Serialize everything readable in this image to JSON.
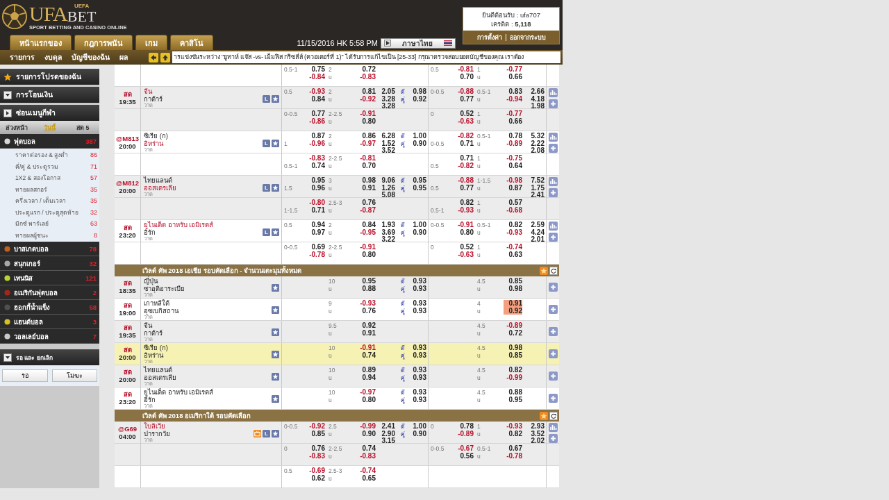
{
  "header": {
    "logo": {
      "brand_left": "UFA",
      "brand_right": "BET",
      "badge": "UEFA",
      "tagline": "SPORT BETTING AND CASINO ONLINE"
    },
    "nav": [
      "หน้าแรกของ",
      "กฎการพนัน",
      "เกม",
      "คาสิโน"
    ],
    "datetime": "11/15/2016 HK 5:58 PM",
    "language": "ภาษาไทย",
    "account": {
      "welcome_label": "ยินดีต้อนรับ :",
      "user": "ufa707",
      "credit_label": "เครดิต :",
      "credit": "5,118",
      "links": [
        "การตั้งค่า",
        "ออกจากระบบ"
      ]
    },
    "submenu": [
      "รายการ",
      "งบดุล",
      "บัญชีของฉัน",
      "ผล"
    ],
    "ticker": "ารแข่งขันระหว่าง \"ยูทาห์ แจ๊ส -vs- เม็มฟิส กริซลี่ส์ (ควอเตอร์ที่ 1)\" ได้รับการแก้ไขเป็น [25-33] กรุณาตรวจสอบยอดบัญชีของคุณ เราต้อง"
  },
  "sidebar": {
    "panels": [
      {
        "kind": "favorites",
        "label": "รายการโปรดของฉัน"
      },
      {
        "kind": "collapse",
        "label": "การโอนเงิน"
      },
      {
        "kind": "expand",
        "label": "ซ่อนเมนูกีฬา"
      }
    ],
    "tabs": [
      {
        "label": "ล่วงหน้า",
        "selected": false
      },
      {
        "label": "วันนี้",
        "selected": true
      },
      {
        "label": "สด 5",
        "selected": false
      }
    ],
    "sports": [
      {
        "name": "ฟุตบอล",
        "count": "387",
        "color": "#d8d8d8",
        "children": [
          {
            "name": "ราคาต่อรอง & สูงต่ำ",
            "count": "86"
          },
          {
            "name": "คี่/คู่ & ประตูรวม",
            "count": "71"
          },
          {
            "name": "1X2 & สองโอกาส",
            "count": "57"
          },
          {
            "name": "ทายผลสกอร์",
            "count": "35"
          },
          {
            "name": "ครึ่งเวลา / เต็มเวลา",
            "count": "35"
          },
          {
            "name": "ประตูแรก / ประตูสุดท้าย",
            "count": "32"
          },
          {
            "name": "มิกซ์ พาร์เลย์",
            "count": "63"
          },
          {
            "name": "ทายผลผู้ชนะ",
            "count": "8"
          }
        ]
      },
      {
        "name": "บาสเกตบอล",
        "count": "78",
        "color": "#c0601a"
      },
      {
        "name": "สนุกเกอร์",
        "count": "32",
        "color": "#a8a8a8"
      },
      {
        "name": "เทนนิส",
        "count": "121",
        "color": "#b8d430"
      },
      {
        "name": "อเมริกันฟุตบอล",
        "count": "2",
        "color": "#a02818"
      },
      {
        "name": "ฮอกกี้น้ำแข็ง",
        "count": "58",
        "color": "#505050"
      },
      {
        "name": "แฮนด์บอล",
        "count": "3",
        "color": "#d8c020"
      },
      {
        "name": "วอลเลย์บอล",
        "count": "7",
        "color": "#c8c8c8"
      }
    ],
    "bottom_panel": {
      "kind": "collapse",
      "label": "รอ และ ยกเลิก"
    },
    "buttons": [
      "รอ",
      "โมฆะ"
    ]
  },
  "sections": [
    {
      "lines": [
        {
          "shaded": false,
          "highlighted": false,
          "ft": {
            "hl": "0.5-1",
            "hl_low": false,
            "hdp": [
              {
                "v": "0.75",
                "red": false
              },
              {
                "v": "-0.84",
                "red": true
              }
            ],
            "ou": [
              "2",
              "u"
            ],
            "ouo": [
              {
                "v": "0.72",
                "red": false
              },
              {
                "v": "-0.83",
                "red": true
              }
            ]
          },
          "h1": {
            "hl": "0.5",
            "hl_low": false,
            "hdp": [
              {
                "v": "-0.81",
                "red": true
              },
              {
                "v": "0.70",
                "red": false
              }
            ],
            "ou": [
              "1",
              "u"
            ],
            "ouo": [
              {
                "v": "-0.77",
                "red": true
              },
              {
                "v": "0.66",
                "red": false
              }
            ]
          }
        },
        {
          "shaded": true,
          "highlighted": false,
          "time": {
            "status": "สด",
            "clock": "19:35"
          },
          "teams": [
            {
              "name": "จีน",
              "fav": true
            },
            {
              "name": "กาต้าร์",
              "fav": false
            }
          ],
          "draw": "วาด",
          "icons": [
            {
              "kind": "live",
              "label": "L"
            },
            {
              "kind": "fav"
            }
          ],
          "actions": [
            {
              "kind": "stats"
            },
            {
              "kind": "add"
            }
          ],
          "ft": {
            "hl": "0.5",
            "hl_low": false,
            "hdp": [
              {
                "v": "-0.93",
                "red": true
              },
              {
                "v": "0.84",
                "red": false
              }
            ],
            "ou": [
              "2",
              "u"
            ],
            "ouo": [
              {
                "v": "0.81",
                "red": false
              },
              {
                "v": "-0.92",
                "red": true
              }
            ],
            "x12": [
              "2.05",
              "3.28",
              "3.28"
            ],
            "oe": [
              "ดี",
              "คู่"
            ],
            "oeo": [
              "0.98",
              "0.92"
            ]
          },
          "h1": {
            "hl": "0-0.5",
            "hl_low": false,
            "hdp": [
              {
                "v": "-0.88",
                "red": true
              },
              {
                "v": "0.77",
                "red": false
              }
            ],
            "ou": [
              "0.5-1",
              "u"
            ],
            "ouo": [
              {
                "v": "0.83",
                "red": false
              },
              {
                "v": "-0.94",
                "red": true
              }
            ],
            "x12": [
              "2.66",
              "4.18",
              "1.98"
            ]
          }
        },
        {
          "shaded": true,
          "highlighted": false,
          "ft": {
            "hl": "0-0.5",
            "hl_low": false,
            "hdp": [
              {
                "v": "0.77",
                "red": false
              },
              {
                "v": "-0.86",
                "red": true
              }
            ],
            "ou": [
              "2-2.5",
              "u"
            ],
            "ouo": [
              {
                "v": "-0.91",
                "red": true
              },
              {
                "v": "0.80",
                "red": false
              }
            ]
          },
          "h1": {
            "hl": "0",
            "hl_low": false,
            "hdp": [
              {
                "v": "0.52",
                "red": false
              },
              {
                "v": "-0.63",
                "red": true
              }
            ],
            "ou": [
              "1",
              "u"
            ],
            "ouo": [
              {
                "v": "-0.77",
                "red": true
              },
              {
                "v": "0.66",
                "red": false
              }
            ]
          }
        },
        {
          "shaded": false,
          "highlighted": false,
          "time": {
            "status": "@M813",
            "clock": "20:00"
          },
          "teams": [
            {
              "name": "ซีเรีย (ก)",
              "fav": false
            },
            {
              "name": "อิหร่าน",
              "fav": true
            }
          ],
          "draw": "วาด",
          "icons": [
            {
              "kind": "live",
              "label": "L"
            },
            {
              "kind": "fav"
            }
          ],
          "actions": [
            {
              "kind": "stats"
            },
            {
              "kind": "add"
            }
          ],
          "ft": {
            "hl": "1",
            "hl_low": true,
            "hdp": [
              {
                "v": "0.87",
                "red": false
              },
              {
                "v": "-0.96",
                "red": true
              }
            ],
            "ou": [
              "2",
              "u"
            ],
            "ouo": [
              {
                "v": "0.86",
                "red": false
              },
              {
                "v": "-0.97",
                "red": true
              }
            ],
            "x12": [
              "6.28",
              "1.52",
              "3.52"
            ],
            "oe": [
              "ดี",
              "คู่"
            ],
            "oeo": [
              "1.00",
              "0.90"
            ]
          },
          "h1": {
            "hl": "0-0.5",
            "hl_low": true,
            "hdp": [
              {
                "v": "-0.82",
                "red": true
              },
              {
                "v": "0.71",
                "red": false
              }
            ],
            "ou": [
              "0.5-1",
              "u"
            ],
            "ouo": [
              {
                "v": "0.78",
                "red": false
              },
              {
                "v": "-0.89",
                "red": true
              }
            ],
            "x12": [
              "5.32",
              "2.22",
              "2.08"
            ]
          }
        },
        {
          "shaded": false,
          "highlighted": false,
          "ft": {
            "hl": "0.5-1",
            "hl_low": true,
            "hdp": [
              {
                "v": "-0.83",
                "red": true
              },
              {
                "v": "0.74",
                "red": false
              }
            ],
            "ou": [
              "2-2.5",
              "u"
            ],
            "ouo": [
              {
                "v": "-0.81",
                "red": true
              },
              {
                "v": "0.70",
                "red": false
              }
            ]
          },
          "h1": {
            "hl": "0.5",
            "hl_low": true,
            "hdp": [
              {
                "v": "0.71",
                "red": false
              },
              {
                "v": "-0.82",
                "red": true
              }
            ],
            "ou": [
              "1",
              "u"
            ],
            "ouo": [
              {
                "v": "-0.75",
                "red": true
              },
              {
                "v": "0.64",
                "red": false
              }
            ]
          }
        },
        {
          "shaded": true,
          "highlighted": false,
          "time": {
            "status": "@M812",
            "clock": "20:00"
          },
          "teams": [
            {
              "name": "ไทยแลนด์",
              "fav": false
            },
            {
              "name": "ออสเตรเลีย",
              "fav": true
            }
          ],
          "draw": "วาด",
          "icons": [
            {
              "kind": "live",
              "label": "L"
            },
            {
              "kind": "fav"
            }
          ],
          "actions": [
            {
              "kind": "stats"
            },
            {
              "kind": "add"
            }
          ],
          "ft": {
            "hl": "1.5",
            "hl_low": true,
            "hdp": [
              {
                "v": "0.95",
                "red": false
              },
              {
                "v": "0.96",
                "red": false
              }
            ],
            "ou": [
              "3",
              "u"
            ],
            "ouo": [
              {
                "v": "0.98",
                "red": false
              },
              {
                "v": "0.91",
                "red": false
              }
            ],
            "x12": [
              "9.06",
              "1.26",
              "5.08"
            ],
            "oe": [
              "ดี",
              "คู่"
            ],
            "oeo": [
              "0.95",
              "0.95"
            ]
          },
          "h1": {
            "hl": "0.5",
            "hl_low": true,
            "hdp": [
              {
                "v": "-0.88",
                "red": true
              },
              {
                "v": "0.77",
                "red": false
              }
            ],
            "ou": [
              "1-1.5",
              "u"
            ],
            "ouo": [
              {
                "v": "-0.98",
                "red": true
              },
              {
                "v": "0.87",
                "red": false
              }
            ],
            "x12": [
              "7.52",
              "1.75",
              "2.41"
            ]
          }
        },
        {
          "shaded": true,
          "highlighted": false,
          "ft": {
            "hl": "1-1.5",
            "hl_low": true,
            "hdp": [
              {
                "v": "-0.80",
                "red": true
              },
              {
                "v": "0.71",
                "red": false
              }
            ],
            "ou": [
              "2.5-3",
              "u"
            ],
            "ouo": [
              {
                "v": "0.76",
                "red": false
              },
              {
                "v": "-0.87",
                "red": true
              }
            ]
          },
          "h1": {
            "hl": "0.5-1",
            "hl_low": true,
            "hdp": [
              {
                "v": "0.82",
                "red": false
              },
              {
                "v": "-0.93",
                "red": true
              }
            ],
            "ou": [
              "1",
              "u"
            ],
            "ouo": [
              {
                "v": "0.57",
                "red": false
              },
              {
                "v": "-0.68",
                "red": true
              }
            ]
          }
        },
        {
          "shaded": false,
          "highlighted": false,
          "time": {
            "status": "สด",
            "clock": "23:20"
          },
          "teams": [
            {
              "name": "ยูไนเต็ด อาหรับ เอมิเรตส์",
              "fav": true
            },
            {
              "name": "อิรัก",
              "fav": false
            }
          ],
          "draw": "วาด",
          "icons": [
            {
              "kind": "live",
              "label": "L"
            },
            {
              "kind": "fav"
            }
          ],
          "actions": [
            {
              "kind": "stats"
            },
            {
              "kind": "add"
            }
          ],
          "ft": {
            "hl": "0.5",
            "hl_low": false,
            "hdp": [
              {
                "v": "0.94",
                "red": false
              },
              {
                "v": "0.97",
                "red": false
              }
            ],
            "ou": [
              "2",
              "u"
            ],
            "ouo": [
              {
                "v": "0.84",
                "red": false
              },
              {
                "v": "-0.95",
                "red": true
              }
            ],
            "x12": [
              "1.93",
              "3.69",
              "3.22"
            ],
            "oe": [
              "ดี",
              "คู่"
            ],
            "oeo": [
              "1.00",
              "0.90"
            ]
          },
          "h1": {
            "hl": "0-0.5",
            "hl_low": false,
            "hdp": [
              {
                "v": "-0.91",
                "red": true
              },
              {
                "v": "0.80",
                "red": false
              }
            ],
            "ou": [
              "0.5-1",
              "u"
            ],
            "ouo": [
              {
                "v": "0.82",
                "red": false
              },
              {
                "v": "-0.93",
                "red": true
              }
            ],
            "x12": [
              "2.59",
              "4.24",
              "2.01"
            ]
          }
        },
        {
          "shaded": false,
          "highlighted": false,
          "ft": {
            "hl": "0-0.5",
            "hl_low": false,
            "hdp": [
              {
                "v": "0.69",
                "red": false
              },
              {
                "v": "-0.78",
                "red": true
              }
            ],
            "ou": [
              "2-2.5",
              "u"
            ],
            "ouo": [
              {
                "v": "-0.91",
                "red": true
              },
              {
                "v": "0.80",
                "red": false
              }
            ]
          },
          "h1": {
            "hl": "0",
            "hl_low": false,
            "hdp": [
              {
                "v": "0.52",
                "red": false
              },
              {
                "v": "-0.63",
                "red": true
              }
            ],
            "ou": [
              "1",
              "u"
            ],
            "ouo": [
              {
                "v": "-0.74",
                "red": true
              },
              {
                "v": "0.63",
                "red": false
              }
            ]
          }
        }
      ]
    },
    {
      "title": "เวิลด์ คัพ 2018 เอเชีย รอบคัดเลือก - จำนวนเตะมุมทั้งหมด",
      "lines": [
        {
          "shaded": true,
          "highlighted": false,
          "time": {
            "status": "สด",
            "clock": "18:35"
          },
          "teams": [
            {
              "name": "ญี่ปุ่น",
              "fav": false
            },
            {
              "name": "ซาอุดิอาระเบีย",
              "fav": false
            }
          ],
          "draw": "วาด",
          "icons": [
            {
              "kind": "fav"
            }
          ],
          "actions": [
            {
              "kind": "add"
            }
          ],
          "ft": {
            "ou": [
              "10",
              "u"
            ],
            "ouo": [
              {
                "v": "0.95",
                "red": false
              },
              {
                "v": "0.88",
                "red": false
              }
            ],
            "oe": [
              "ดี",
              "คู่"
            ],
            "oeo": [
              "0.93",
              "0.93"
            ]
          },
          "h1": {
            "ou": [
              "4.5",
              "u"
            ],
            "ouo": [
              {
                "v": "0.85",
                "red": false
              },
              {
                "v": "0.98",
                "red": false
              }
            ],
            "flash": false
          }
        },
        {
          "shaded": false,
          "highlighted": false,
          "time": {
            "status": "สด",
            "clock": "19:00"
          },
          "teams": [
            {
              "name": "เกาหลีใต้",
              "fav": false
            },
            {
              "name": "อุซเบกิสถาน",
              "fav": false
            }
          ],
          "draw": "วาด",
          "icons": [
            {
              "kind": "fav"
            }
          ],
          "actions": [
            {
              "kind": "add"
            }
          ],
          "ft": {
            "ou": [
              "9",
              "u"
            ],
            "ouo": [
              {
                "v": "-0.93",
                "red": true
              },
              {
                "v": "0.76",
                "red": false
              }
            ],
            "oe": [
              "ดี",
              "คู่"
            ],
            "oeo": [
              "0.93",
              "0.93"
            ]
          },
          "h1": {
            "ou": [
              "4",
              "u"
            ],
            "ouo": [
              {
                "v": "0.91",
                "red": false
              },
              {
                "v": "0.92",
                "red": false
              }
            ],
            "flash": true
          }
        },
        {
          "shaded": true,
          "highlighted": false,
          "time": {
            "status": "สด",
            "clock": "19:35"
          },
          "teams": [
            {
              "name": "จีน",
              "fav": false
            },
            {
              "name": "กาต้าร์",
              "fav": false
            }
          ],
          "draw": "วาด",
          "icons": [
            {
              "kind": "fav"
            }
          ],
          "actions": [
            {
              "kind": "add"
            }
          ],
          "ft": {
            "ou": [
              "9.5",
              "u"
            ],
            "ouo": [
              {
                "v": "0.92",
                "red": false
              },
              {
                "v": "0.91",
                "red": false
              }
            ]
          },
          "h1": {
            "ou": [
              "4.5",
              "u"
            ],
            "ouo": [
              {
                "v": "-0.89",
                "red": true
              },
              {
                "v": "0.72",
                "red": false
              }
            ],
            "flash": false
          }
        },
        {
          "highlighted": true,
          "time": {
            "status": "สด",
            "clock": "20:00"
          },
          "teams": [
            {
              "name": "ซีเรีย (ก)",
              "fav": false
            },
            {
              "name": "อิหร่าน",
              "fav": false
            }
          ],
          "draw": "วาด",
          "icons": [
            {
              "kind": "fav"
            }
          ],
          "actions": [
            {
              "kind": "add"
            }
          ],
          "ft": {
            "ou": [
              "10",
              "u"
            ],
            "ouo": [
              {
                "v": "-0.91",
                "red": true
              },
              {
                "v": "0.74",
                "red": false
              }
            ],
            "oe": [
              "ดี",
              "คู่"
            ],
            "oeo": [
              "0.93",
              "0.93"
            ]
          },
          "h1": {
            "ou": [
              "4.5",
              "u"
            ],
            "ouo": [
              {
                "v": "0.98",
                "red": false
              },
              {
                "v": "0.85",
                "red": false
              }
            ],
            "flash": false
          }
        },
        {
          "shaded": true,
          "highlighted": false,
          "time": {
            "status": "สด",
            "clock": "20:00"
          },
          "teams": [
            {
              "name": "ไทยแลนด์",
              "fav": false
            },
            {
              "name": "ออสเตรเลีย",
              "fav": false
            }
          ],
          "draw": "วาด",
          "icons": [
            {
              "kind": "fav"
            }
          ],
          "actions": [
            {
              "kind": "add"
            }
          ],
          "ft": {
            "ou": [
              "10",
              "u"
            ],
            "ouo": [
              {
                "v": "0.89",
                "red": false
              },
              {
                "v": "0.94",
                "red": false
              }
            ],
            "oe": [
              "ดี",
              "คู่"
            ],
            "oeo": [
              "0.93",
              "0.93"
            ]
          },
          "h1": {
            "ou": [
              "4.5",
              "u"
            ],
            "ouo": [
              {
                "v": "0.82",
                "red": false
              },
              {
                "v": "-0.99",
                "red": true
              }
            ],
            "flash": false
          }
        },
        {
          "shaded": false,
          "highlighted": false,
          "time": {
            "status": "สด",
            "clock": "23:20"
          },
          "teams": [
            {
              "name": "ยูไนเต็ด อาหรับ เอมิเรตส์",
              "fav": false
            },
            {
              "name": "อิรัก",
              "fav": false
            }
          ],
          "draw": "วาด",
          "icons": [
            {
              "kind": "fav"
            }
          ],
          "actions": [
            {
              "kind": "add"
            }
          ],
          "ft": {
            "ou": [
              "10",
              "u"
            ],
            "ouo": [
              {
                "v": "-0.97",
                "red": true
              },
              {
                "v": "0.80",
                "red": false
              }
            ],
            "oe": [
              "ดี",
              "คู่"
            ],
            "oeo": [
              "0.93",
              "0.93"
            ]
          },
          "h1": {
            "ou": [
              "4.5",
              "u"
            ],
            "ouo": [
              {
                "v": "0.88",
                "red": false
              },
              {
                "v": "0.95",
                "red": false
              }
            ],
            "flash": false
          }
        }
      ]
    },
    {
      "title": "เวิลด์ คัพ 2018 อเมริกาใต้ รอบคัดเลือก",
      "lines": [
        {
          "shaded": true,
          "highlighted": false,
          "time": {
            "status": "@G69",
            "clock": "04:00"
          },
          "teams": [
            {
              "name": "โบลิเวีย",
              "fav": true
            },
            {
              "name": "ปารากวัย",
              "fav": false
            }
          ],
          "draw": "วาด",
          "icons": [
            {
              "kind": "tv"
            },
            {
              "kind": "live",
              "label": "L"
            },
            {
              "kind": "fav"
            }
          ],
          "actions": [
            {
              "kind": "stats"
            },
            {
              "kind": "add"
            }
          ],
          "ft": {
            "hl": "0-0.5",
            "hl_low": false,
            "hdp": [
              {
                "v": "-0.92",
                "red": true
              },
              {
                "v": "0.85",
                "red": false
              }
            ],
            "ou": [
              "2.5",
              "u"
            ],
            "ouo": [
              {
                "v": "-0.99",
                "red": true
              },
              {
                "v": "0.90",
                "red": false
              }
            ],
            "x12": [
              "2.41",
              "2.90",
              "3.15"
            ],
            "oe": [
              "ดี",
              "คู่"
            ],
            "oeo": [
              "1.00",
              "0.90"
            ]
          },
          "h1": {
            "hl": "0",
            "hl_low": false,
            "hdp": [
              {
                "v": "0.78",
                "red": false
              },
              {
                "v": "-0.89",
                "red": true
              }
            ],
            "ou": [
              "1",
              "u"
            ],
            "ouo": [
              {
                "v": "-0.93",
                "red": true
              },
              {
                "v": "0.82",
                "red": false
              }
            ],
            "x12": [
              "2.93",
              "3.52",
              "2.02"
            ]
          }
        },
        {
          "shaded": true,
          "highlighted": false,
          "ft": {
            "hl": "0",
            "hl_low": false,
            "hdp": [
              {
                "v": "0.76",
                "red": false
              },
              {
                "v": "-0.83",
                "red": true
              }
            ],
            "ou": [
              "2-2.5",
              "u"
            ],
            "ouo": [
              {
                "v": "0.74",
                "red": false
              },
              {
                "v": "-0.83",
                "red": true
              }
            ]
          },
          "h1": {
            "hl": "0-0.5",
            "hl_low": false,
            "hdp": [
              {
                "v": "-0.67",
                "red": true
              },
              {
                "v": "0.56",
                "red": false
              }
            ],
            "ou": [
              "0.5-1",
              "u"
            ],
            "ouo": [
              {
                "v": "0.67",
                "red": false
              },
              {
                "v": "-0.78",
                "red": true
              }
            ]
          }
        },
        {
          "shaded": false,
          "highlighted": false,
          "ft": {
            "hl": "0.5",
            "hl_low": false,
            "hdp": [
              {
                "v": "-0.69",
                "red": true
              },
              {
                "v": "0.62",
                "red": false
              }
            ],
            "ou": [
              "2.5-3",
              "u"
            ],
            "ouo": [
              {
                "v": "-0.74",
                "red": true
              },
              {
                "v": "0.65",
                "red": false
              }
            ]
          }
        }
      ]
    }
  ]
}
